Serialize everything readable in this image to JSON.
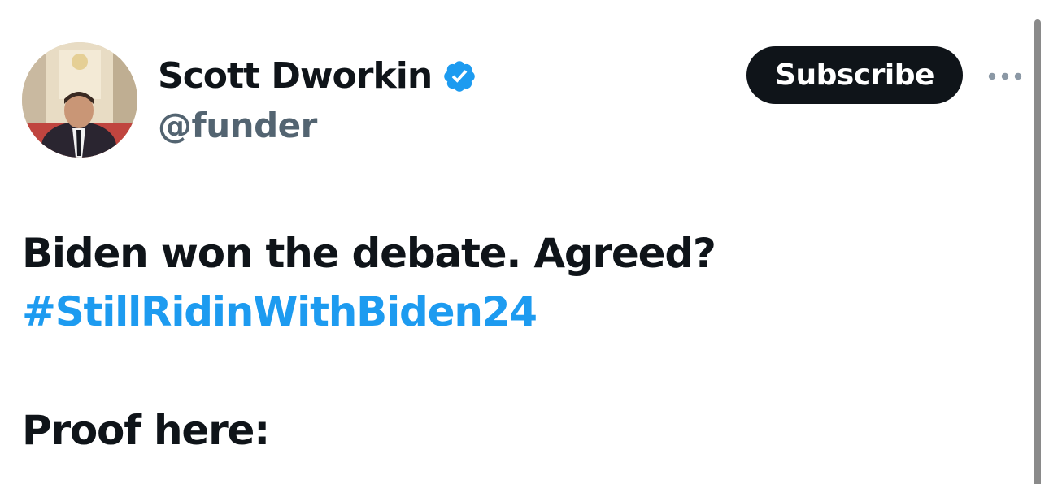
{
  "author": {
    "display_name": "Scott Dworkin",
    "handle": "@funder",
    "verified": true,
    "verified_color": "#1d9bf0"
  },
  "actions": {
    "subscribe_label": "Subscribe",
    "more_icon": "more-horizontal-icon"
  },
  "tweet": {
    "line1": "Biden won the debate. Agreed?",
    "hashtag": "#StillRidinWithBiden24",
    "line2": "Proof here:"
  },
  "colors": {
    "text": "#0f1419",
    "secondary": "#536471",
    "link": "#1d9bf0",
    "button_bg": "#0f1419"
  }
}
